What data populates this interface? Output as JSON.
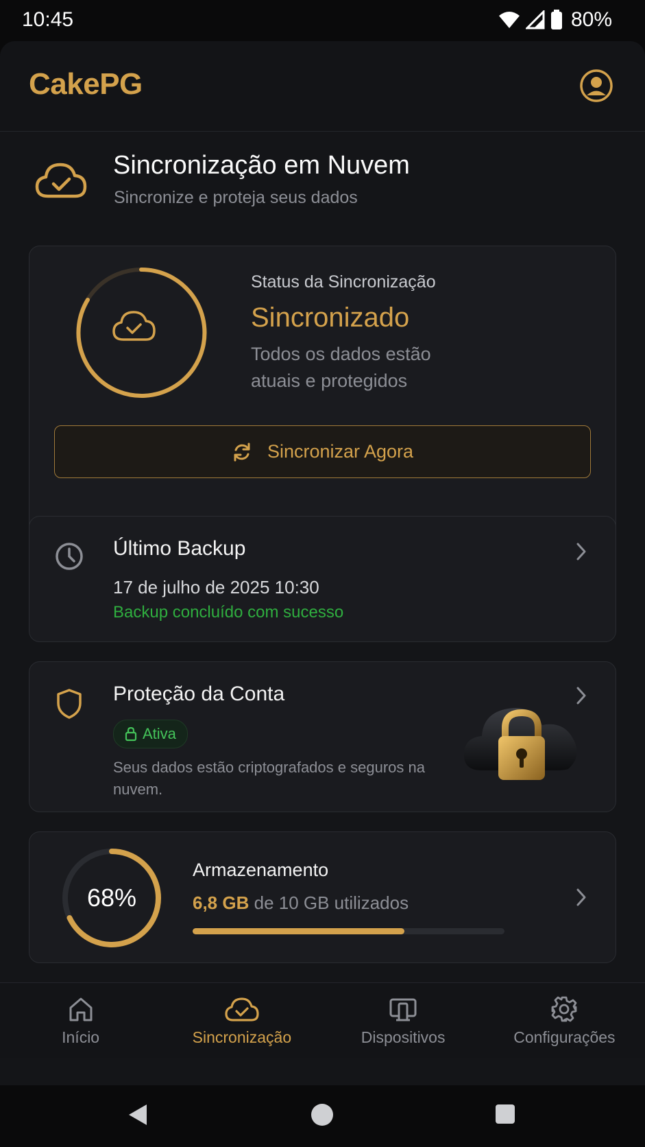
{
  "status_bar": {
    "time": "10:45",
    "battery": "80%"
  },
  "header": {
    "logo": "CakePG",
    "icons": [
      "account-circle-icon"
    ]
  },
  "section": {
    "title": "Sincronização em Nuvem",
    "subtitle": "Sincronize e proteja seus dados",
    "icon": "cloud-check-icon"
  },
  "sync_card": {
    "status_label": "Status da Sincronização",
    "status_value": "Sincronizado",
    "status_desc": "Todos os dados estão atuais e protegidos",
    "button_label": "Sincronizar Agora"
  },
  "backup_card": {
    "title": "Último Backup",
    "date": "17 de julho de 2025 10:30",
    "result": "Backup concluído com sucesso"
  },
  "protection_card": {
    "title": "Proteção da Conta",
    "badge": "Ativa",
    "description": "Seus dados estão criptografados e seguros na nuvem."
  },
  "storage_card": {
    "title": "Armazenamento",
    "percent_label": "68%",
    "used": "6,8 GB",
    "total_text": "de 10 GB utilizados",
    "used_fraction": 0.68
  },
  "bottom_nav": [
    {
      "label": "Início",
      "icon": "home-icon",
      "active": false
    },
    {
      "label": "Sincronização",
      "icon": "cloud-check-icon",
      "active": true
    },
    {
      "label": "Dispositivos",
      "icon": "devices-icon",
      "active": false
    },
    {
      "label": "Configurações",
      "icon": "gear-icon",
      "active": false
    }
  ],
  "colors": {
    "accent": "#d4a24c",
    "success": "#2fae3f",
    "background": "#141518",
    "card": "#1a1b1f"
  }
}
